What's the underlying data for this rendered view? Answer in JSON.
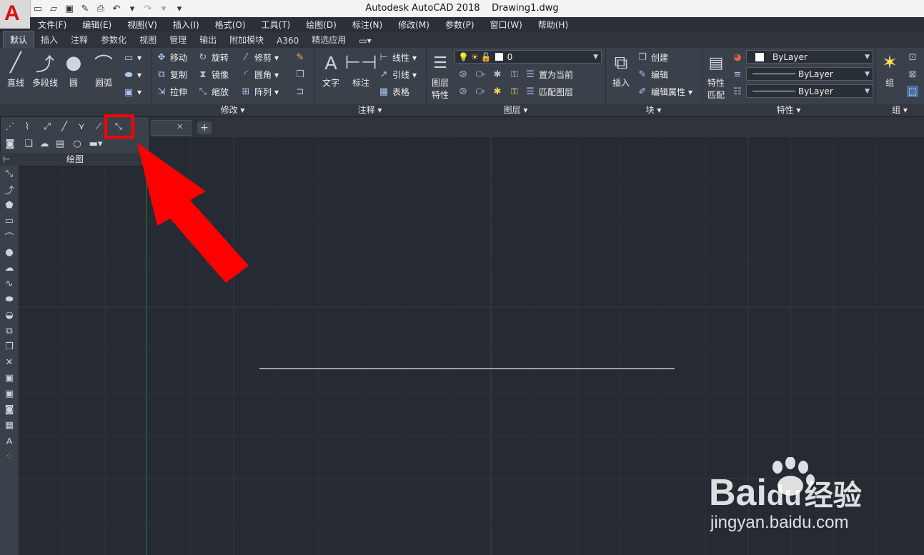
{
  "window": {
    "app_title": "Autodesk AutoCAD 2018",
    "document_name": "Drawing1.dwg"
  },
  "menubar": [
    "文件(F)",
    "编辑(E)",
    "视图(V)",
    "插入(I)",
    "格式(O)",
    "工具(T)",
    "绘图(D)",
    "标注(N)",
    "修改(M)",
    "参数(P)",
    "窗口(W)",
    "帮助(H)"
  ],
  "tabs": [
    "默认",
    "插入",
    "注释",
    "参数化",
    "视图",
    "管理",
    "输出",
    "附加模块",
    "A360",
    "精选应用"
  ],
  "ribbon": {
    "draw": {
      "line": "直线",
      "polyline": "多段线",
      "circle": "圆",
      "arc": "圆弧",
      "title": "绘图"
    },
    "modify": {
      "move": "移动",
      "rotate": "旋转",
      "trim": "修剪",
      "copy": "复制",
      "mirror": "镜像",
      "fillet": "圆角",
      "stretch": "拉伸",
      "scale": "缩放",
      "array": "阵列",
      "title": "修改"
    },
    "annotation": {
      "text": "文字",
      "dimension": "标注",
      "linear": "线性",
      "leader": "引线",
      "table": "表格",
      "title": "注释"
    },
    "layers": {
      "layer_properties_1": "图层",
      "layer_properties_2": "特性",
      "current_layer": "0",
      "set_current": "置为当前",
      "match_layer": "匹配图层",
      "title": "图层"
    },
    "block": {
      "insert": "插入",
      "create": "创建",
      "edit": "编辑",
      "edit_attributes": "编辑属性",
      "title": "块"
    },
    "properties": {
      "match_1": "特性",
      "match_2": "匹配",
      "color": "ByLayer",
      "linetype": "ByLayer",
      "lineweight": "ByLayer",
      "title": "特性"
    },
    "groups": {
      "group": "组",
      "title": "组"
    }
  },
  "flyout": {
    "title": "绘图"
  },
  "watermark": {
    "brand": "Bai",
    "brand2": "du",
    "cn": "经验",
    "url": "jingyan.baidu.com"
  },
  "colors": {
    "highlight": "#ff0000",
    "arrow": "#ff0000",
    "canvas": "#252a33"
  }
}
